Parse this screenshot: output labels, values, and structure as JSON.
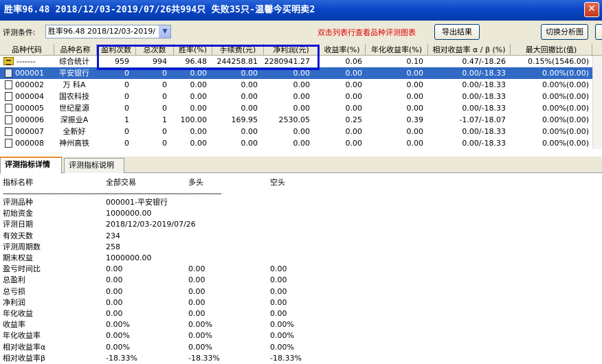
{
  "window": {
    "title": "胜率96.48  2018/12/03-2019/07/26共994只 失败35只-温馨今买明卖2",
    "close_glyph": "✕"
  },
  "toolbar": {
    "condition_label": "评测条件:",
    "condition_value": "胜率96.48  2018/12/03-2019/",
    "hint": "双击列表行查看品种评测图表",
    "export_label": "导出结果",
    "switch_label": "切换分析图"
  },
  "table": {
    "headers": [
      "品种代码",
      "品种名称",
      "盈利次数",
      "总次数",
      "胜率(%)",
      "手续费(元)",
      "净利润(元)",
      "收益率(%)",
      "年化收益率(%)",
      "相对收益率 α / β (%)",
      "最大回撤比(值)"
    ],
    "rows": [
      {
        "code": "-------",
        "name": "综合统计",
        "wins": "959",
        "total": "994",
        "winrate": "96.48",
        "fee": "244258.81",
        "profit": "2280941.27",
        "ret": "0.06",
        "annual": "0.10",
        "ab": "0.47/-18.26",
        "drawdown": "0.15%(1546.00)",
        "icon": "summary-icon"
      },
      {
        "code": "000001",
        "name": "平安银行",
        "wins": "0",
        "total": "0",
        "winrate": "0.00",
        "fee": "0.00",
        "profit": "0.00",
        "ret": "0.00",
        "annual": "0.00",
        "ab": "0.00/-18.33",
        "drawdown": "0.00%(0.00)",
        "icon": "document-icon"
      },
      {
        "code": "000002",
        "name": "万 科A",
        "wins": "0",
        "total": "0",
        "winrate": "0.00",
        "fee": "0.00",
        "profit": "0.00",
        "ret": "0.00",
        "annual": "0.00",
        "ab": "0.00/-18.33",
        "drawdown": "0.00%(0.00)",
        "icon": "document-icon"
      },
      {
        "code": "000004",
        "name": "国农科技",
        "wins": "0",
        "total": "0",
        "winrate": "0.00",
        "fee": "0.00",
        "profit": "0.00",
        "ret": "0.00",
        "annual": "0.00",
        "ab": "0.00/-18.33",
        "drawdown": "0.00%(0.00)",
        "icon": "document-icon"
      },
      {
        "code": "000005",
        "name": "世纪星源",
        "wins": "0",
        "total": "0",
        "winrate": "0.00",
        "fee": "0.00",
        "profit": "0.00",
        "ret": "0.00",
        "annual": "0.00",
        "ab": "0.00/-18.33",
        "drawdown": "0.00%(0.00)",
        "icon": "document-icon"
      },
      {
        "code": "000006",
        "name": "深振业A",
        "wins": "1",
        "total": "1",
        "winrate": "100.00",
        "fee": "169.95",
        "profit": "2530.05",
        "ret": "0.25",
        "annual": "0.39",
        "ab": "-1.07/-18.07",
        "drawdown": "0.00%(0.00)",
        "icon": "document-icon"
      },
      {
        "code": "000007",
        "name": "全新好",
        "wins": "0",
        "total": "0",
        "winrate": "0.00",
        "fee": "0.00",
        "profit": "0.00",
        "ret": "0.00",
        "annual": "0.00",
        "ab": "0.00/-18.33",
        "drawdown": "0.00%(0.00)",
        "icon": "document-icon"
      },
      {
        "code": "000008",
        "name": "神州高铁",
        "wins": "0",
        "total": "0",
        "winrate": "0.00",
        "fee": "0.00",
        "profit": "0.00",
        "ret": "0.00",
        "annual": "0.00",
        "ab": "0.00/-18.33",
        "drawdown": "0.00%(0.00)",
        "icon": "document-icon"
      }
    ]
  },
  "tabs": [
    "评测指标详情",
    "评测指标说明"
  ],
  "detail": {
    "headers": {
      "name": "指标名称",
      "all": "全部交易",
      "long": "多头",
      "short": "空头"
    },
    "separator": "-----------------------------------------------------------------------------------------------------------",
    "rows": [
      {
        "label": "评测品种",
        "all": "000001-平安银行",
        "long": "",
        "short": ""
      },
      {
        "label": "初始资金",
        "all": "1000000.00",
        "long": "",
        "short": ""
      },
      {
        "label": "评测日期",
        "all": "2018/12/03-2019/07/26",
        "long": "",
        "short": ""
      },
      {
        "label": "有效天数",
        "all": "234",
        "long": "",
        "short": ""
      },
      {
        "label": "评测周期数",
        "all": "258",
        "long": "",
        "short": ""
      },
      {
        "label": "期末权益",
        "all": "1000000.00",
        "long": "",
        "short": ""
      },
      {
        "label": "盈亏时间比",
        "all": "0.00",
        "long": "0.00",
        "short": "0.00"
      },
      {
        "label": "总盈利",
        "all": "0.00",
        "long": "0.00",
        "short": "0.00"
      },
      {
        "label": "总亏损",
        "all": "0.00",
        "long": "0.00",
        "short": "0.00"
      },
      {
        "label": "净利润",
        "all": "0.00",
        "long": "0.00",
        "short": "0.00"
      },
      {
        "label": "年化收益",
        "all": "0.00",
        "long": "0.00",
        "short": "0.00"
      },
      {
        "label": "收益率",
        "all": "0.00%",
        "long": "0.00%",
        "short": "0.00%"
      },
      {
        "label": "年化收益率",
        "all": "0.00%",
        "long": "0.00%",
        "short": "0.00%"
      },
      {
        "label": "相对收益率α",
        "all": "0.00%",
        "long": "0.00%",
        "short": "0.00%"
      },
      {
        "label": "相对收益率β",
        "all": "-18.33%",
        "long": "-18.33%",
        "short": "-18.33%"
      }
    ]
  },
  "colors": {
    "title_bar": "#0a46c6",
    "selection": "#316ac5",
    "highlight_box": "#0a14d6",
    "hint_text": "#e00000"
  }
}
